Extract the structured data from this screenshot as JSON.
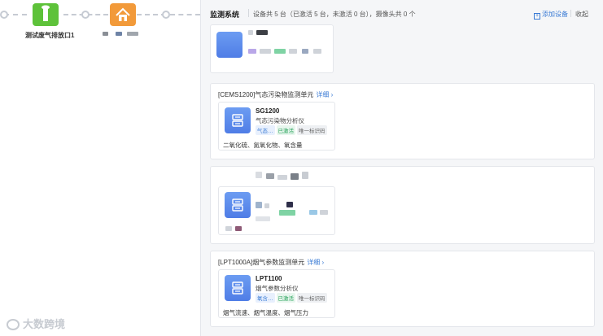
{
  "canvas": {
    "nodes": [
      {
        "label": "测试废气排放口1",
        "icon": "chimney-icon",
        "color": "#5ec23a"
      },
      {
        "label": "",
        "icon": "home-icon",
        "color": "#f29a3a"
      }
    ]
  },
  "panel": {
    "title": "监测系统",
    "stats": "设备共 5 台（已激活 5 台，未激活 0 台），摄像头共 0 个",
    "add_device": "添加设备",
    "collapse": "收起",
    "groups": [
      {
        "title": "",
        "detail": "",
        "device": {
          "name": "",
          "sub": "",
          "tags": []
        },
        "params": ""
      },
      {
        "title": "[CEMS1200]气态污染物监测单元",
        "detail": "详细 ›",
        "device": {
          "name": "SG1200",
          "sub": "气态污染物分析仪",
          "tags": [
            "气态…",
            "已激活",
            "唯一标识码"
          ]
        },
        "params": "二氧化硫、氮氧化物、氧含量"
      },
      {
        "title": "",
        "detail": "",
        "device": {
          "name": "",
          "sub": "",
          "tags": []
        },
        "params": ""
      },
      {
        "title": "[LPT1000A]烟气参数监测单元",
        "detail": "详细 ›",
        "device": {
          "name": "LPT1100",
          "sub": "烟气参数分析仪",
          "tags": [
            "氧含…",
            "已激活",
            "唯一标识码"
          ]
        },
        "params": "烟气流速、烟气温度、烟气压力"
      }
    ]
  },
  "watermark": "大数跨境",
  "colors": {
    "accent": "#3a7bd5",
    "active_green": "#27a35a",
    "device_icon": "#5b87ea"
  }
}
